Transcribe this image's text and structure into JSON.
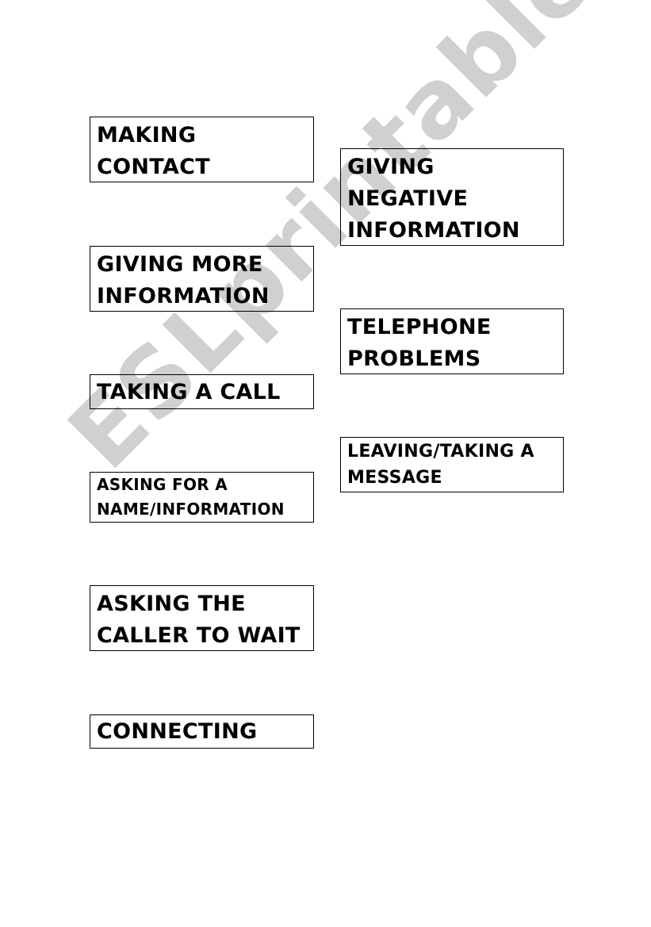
{
  "watermark": "ESLprintables.com",
  "left_column": [
    {
      "label": "MAKING\nCONTACT"
    },
    {
      "label": "GIVING MORE\nINFORMATION"
    },
    {
      "label": "TAKING A CALL"
    },
    {
      "label": "ASKING FOR A\nNAME/INFORMATION"
    },
    {
      "label": "ASKING THE\nCALLER TO WAIT"
    },
    {
      "label": "CONNECTING"
    }
  ],
  "right_column": [
    {
      "label": "GIVING\nNEGATIVE\nINFORMATION"
    },
    {
      "label": "TELEPHONE\nPROBLEMS"
    },
    {
      "label": "LEAVING/TAKING A\nMESSAGE"
    }
  ]
}
